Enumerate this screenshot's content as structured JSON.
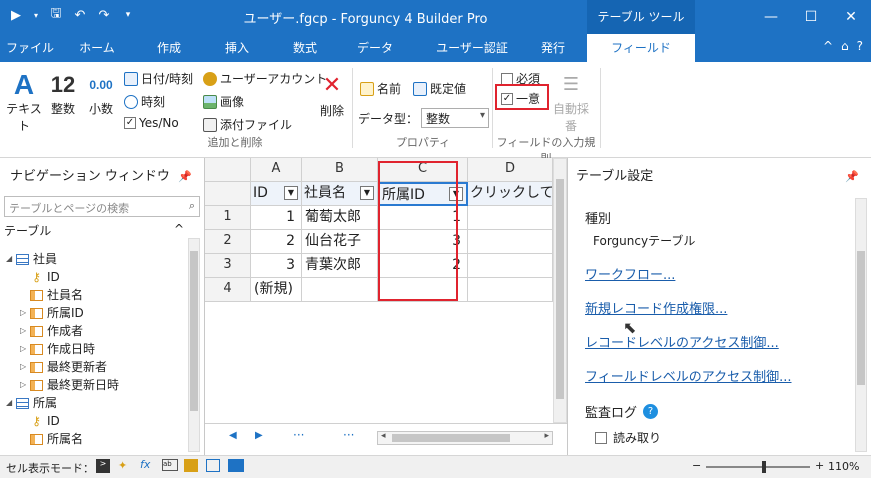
{
  "window": {
    "title": "ユーザー.fgcp - Forguncy 4 Builder Pro",
    "context_tab": "テーブル ツール"
  },
  "tabs": [
    "ファイル",
    "ホーム",
    "作成",
    "挿入",
    "数式",
    "データ",
    "ユーザー認証",
    "発行",
    "フィールド"
  ],
  "ribbon": {
    "text_btn": "テキスト",
    "integer_btn": "整数",
    "integer_icon": "12",
    "decimal_btn": "小数",
    "decimal_icon": "0.00",
    "datetime": "日付/時刻",
    "time": "時刻",
    "yesno": "Yes/No",
    "user_account": "ユーザーアカウント",
    "image": "画像",
    "attachment": "添付ファイル",
    "delete": "削除",
    "group_add_delete": "追加と削除",
    "name": "名前",
    "default_value": "既定値",
    "data_type_label": "データ型：",
    "data_type_value": "整数",
    "group_property": "プロパティ",
    "required": "必須",
    "unique": "一意",
    "auto_number": "自動採番",
    "group_rules": "フィールドの入力規則"
  },
  "nav": {
    "title": "ナビゲーション ウィンドウ",
    "search_placeholder": "テーブルとページの検索",
    "section": "テーブル",
    "items": [
      {
        "label": "社員",
        "type": "table",
        "indent": 0
      },
      {
        "label": "ID",
        "type": "key",
        "indent": 1
      },
      {
        "label": "社員名",
        "type": "col",
        "indent": 1
      },
      {
        "label": "所属ID",
        "type": "col-exp",
        "indent": 1
      },
      {
        "label": "作成者",
        "type": "col-exp",
        "indent": 1
      },
      {
        "label": "作成日時",
        "type": "col-exp",
        "indent": 1
      },
      {
        "label": "最終更新者",
        "type": "col-exp",
        "indent": 1
      },
      {
        "label": "最終更新日時",
        "type": "col-exp",
        "indent": 1
      },
      {
        "label": "所属",
        "type": "table",
        "indent": 0
      },
      {
        "label": "ID",
        "type": "key",
        "indent": 1
      },
      {
        "label": "所属名",
        "type": "col",
        "indent": 1
      }
    ]
  },
  "grid": {
    "col_headers": [
      "A",
      "B",
      "C",
      "D"
    ],
    "field_headers": [
      "ID",
      "社員名",
      "所属ID",
      "クリックして追"
    ],
    "rows": [
      {
        "num": "1",
        "id": "1",
        "name": "葡萄太郎",
        "dept": "1"
      },
      {
        "num": "2",
        "id": "2",
        "name": "仙台花子",
        "dept": "3"
      },
      {
        "num": "3",
        "id": "3",
        "name": "青葉次郎",
        "dept": "2"
      },
      {
        "num": "4",
        "id": "(新規)",
        "name": "",
        "dept": ""
      }
    ],
    "dots": "···"
  },
  "settings": {
    "title": "テーブル設定",
    "kind_label": "種別",
    "kind_value": "Forguncyテーブル",
    "links": [
      "ワークフロー...",
      "新規レコード作成権限...",
      "レコードレベルのアクセス制御...",
      "フィールドレベルのアクセス制御..."
    ],
    "audit_label": "監査ログ",
    "audit_read": "読み取り"
  },
  "status": {
    "mode_label": "セル表示モード：",
    "zoom": "110%"
  }
}
